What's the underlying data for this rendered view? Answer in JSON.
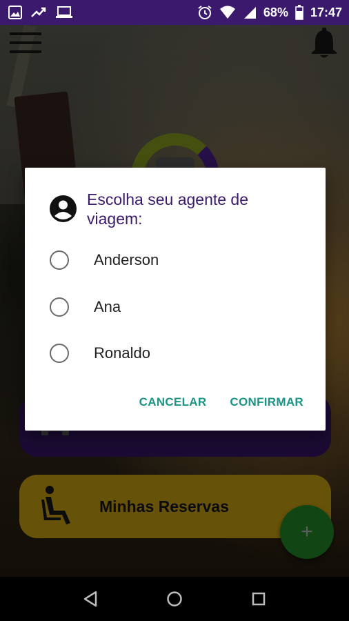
{
  "status_bar": {
    "battery": "68%",
    "time": "17:47",
    "left_icons": [
      "image-icon",
      "trending-icon",
      "laptop-icon"
    ],
    "right_icons": [
      "alarm-icon",
      "wifi-icon",
      "signal-icon",
      "battery-icon"
    ]
  },
  "header": {
    "menu_icon": "hamburger-menu-icon",
    "notification_icon": "bell-icon"
  },
  "cards": {
    "purple_icon": "bus-icon",
    "yellow_label": "Minhas Reservas",
    "yellow_icon": "seat-icon"
  },
  "fab": {
    "label": "+"
  },
  "dialog": {
    "title": "Escolha seu agente de viagem:",
    "icon": "account-circle-icon",
    "options": [
      {
        "label": "Anderson",
        "selected": false
      },
      {
        "label": "Ana",
        "selected": false
      },
      {
        "label": "Ronaldo",
        "selected": false
      }
    ],
    "cancel_label": "CANCELAR",
    "confirm_label": "CONFIRMAR"
  },
  "colors": {
    "brand_purple": "#3b1a6e",
    "accent_teal": "#199485",
    "fab_green": "#1c6b1f",
    "card_yellow": "#9e7e0e"
  }
}
